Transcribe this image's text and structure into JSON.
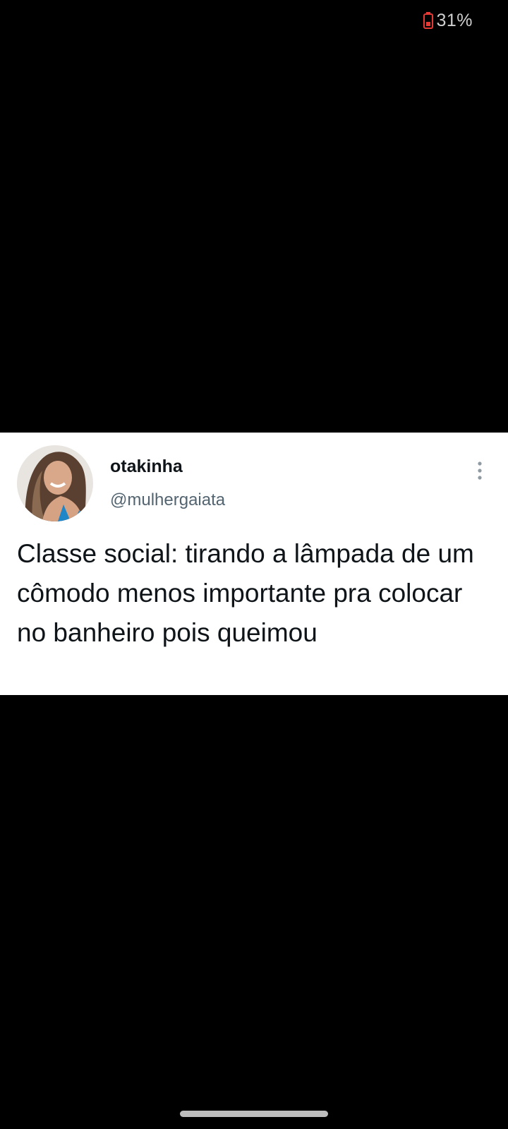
{
  "status_bar": {
    "battery_percent": "31%",
    "battery_icon": "battery-low-icon",
    "battery_color": "#e53935"
  },
  "tweet": {
    "display_name": "otakinha",
    "handle": "@mulhergaiata",
    "text": "Classe social: tirando a lâmpada de um cômodo menos importante pra colocar no banheiro pois queimou",
    "avatar_icon": "profile-photo",
    "more_icon": "more-vertical-icon"
  },
  "colors": {
    "background": "#000000",
    "card": "#ffffff",
    "text_primary": "#0f1419",
    "text_secondary": "#536471"
  }
}
